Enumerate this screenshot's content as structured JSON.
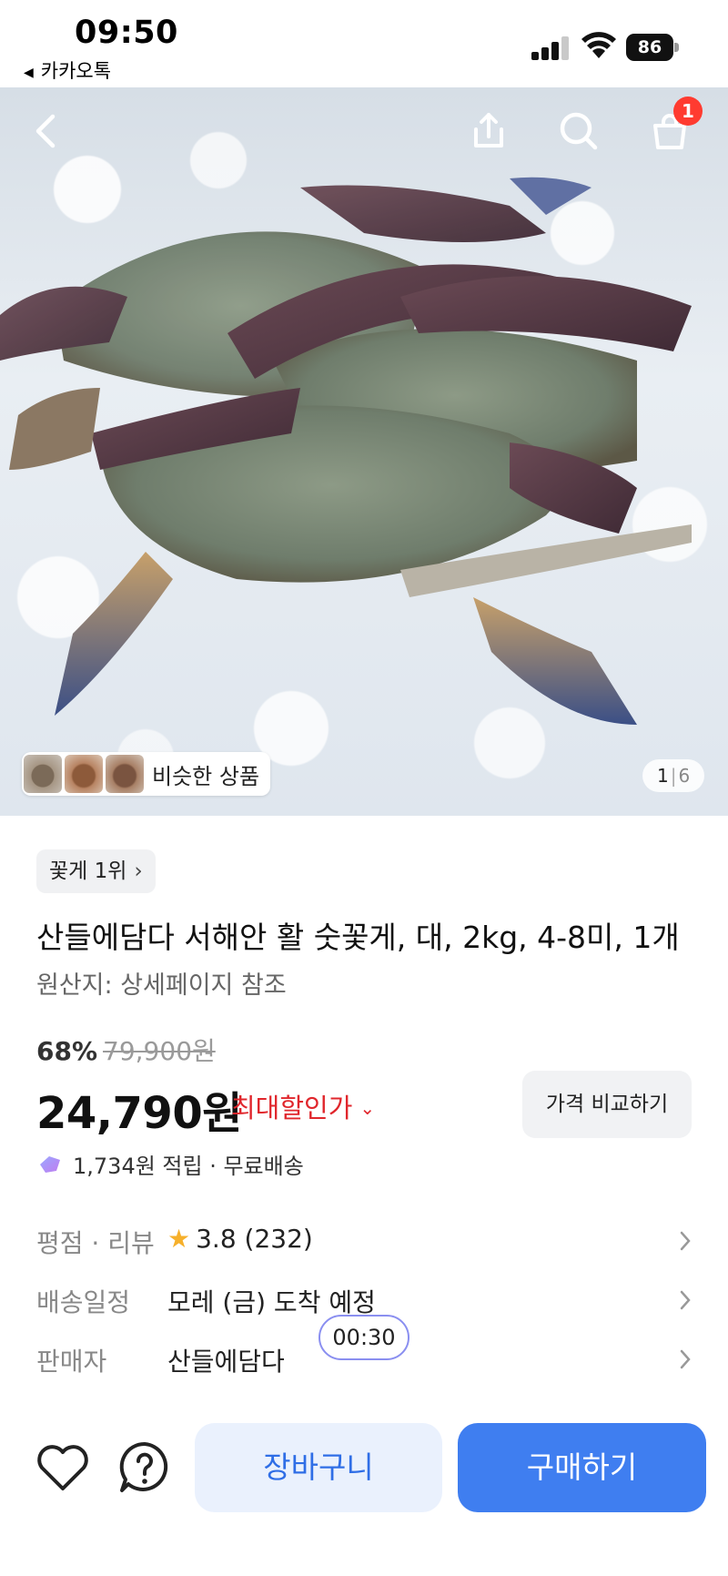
{
  "status_bar": {
    "time": "09:50",
    "back_app": "카카오톡",
    "battery": "86"
  },
  "header": {
    "cart_badge": "1",
    "icons": [
      "back-icon",
      "share-icon",
      "search-icon",
      "cart-icon"
    ]
  },
  "gallery": {
    "similar_label": "비슷한 상품",
    "current_page": "1",
    "total_pages": "6"
  },
  "product": {
    "rank_label": "꽃게 1위",
    "title": "산들에담다 서해안 활 숫꽃게, 대, 2kg, 4-8미, 1개",
    "origin": "원산지: 상세페이지 참조",
    "discount_pct": "68%",
    "original_price": "79,900원",
    "price": "24,790원",
    "max_discount_label": "최대할인가",
    "compare_label": "가격 비교하기",
    "points_text": "1,734원 적립 · 무료배송"
  },
  "info": {
    "rating_key": "평점 · 리뷰",
    "rating_value": "3.8 (232)",
    "delivery_key": "배송일정",
    "delivery_value": "모레 (금) 도착 예정",
    "seller_key": "판매자",
    "seller_value": "산들에담다"
  },
  "timer": "00:30",
  "bottom": {
    "cart_label": "장바구니",
    "buy_label": "구매하기"
  },
  "colors": {
    "accent_blue": "#3f7ef0",
    "discount_red": "#e0262c",
    "badge_red": "#ff3b30",
    "star_yellow": "#f6b02b"
  }
}
